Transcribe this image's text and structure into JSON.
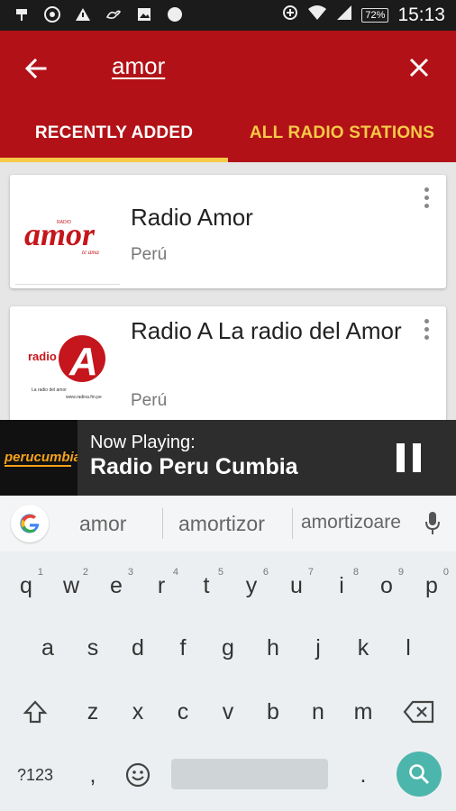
{
  "status_bar": {
    "time": "15:13",
    "battery_percent": "72%",
    "left_icons": [
      "usb-icon",
      "chrome-icon",
      "warning-icon",
      "bird-icon",
      "image-icon",
      "circle-icon"
    ],
    "right_icons": [
      "data-saver-icon",
      "wifi-icon",
      "signal-icon"
    ]
  },
  "toolbar": {
    "search_query": "amor"
  },
  "tabs": [
    {
      "label": "RECENTLY ADDED",
      "active": true
    },
    {
      "label": "ALL RADIO STATIONS",
      "active": false
    }
  ],
  "stations": [
    {
      "name": "Radio Amor",
      "country": "Perú"
    },
    {
      "name": "Radio A La radio del Amor",
      "country": "Perú"
    }
  ],
  "logos": {
    "amor_wordmark": "amor",
    "amor_small": "RADIO",
    "amor_tagline": "te ama",
    "a_wordmark": "radio",
    "a_letter": "A",
    "a_tagline": "La radio del amor",
    "a_url": "www.radioa.fm.pe",
    "cumbia_wordmark": "perucumbia"
  },
  "now_playing": {
    "label": "Now Playing:",
    "station": "Radio Peru Cumbia"
  },
  "keyboard": {
    "suggestions": [
      "amor",
      "amortizor",
      "amortizoare"
    ],
    "row1": [
      {
        "key": "q",
        "hint": "1"
      },
      {
        "key": "w",
        "hint": "2"
      },
      {
        "key": "e",
        "hint": "3"
      },
      {
        "key": "r",
        "hint": "4"
      },
      {
        "key": "t",
        "hint": "5"
      },
      {
        "key": "y",
        "hint": "6"
      },
      {
        "key": "u",
        "hint": "7"
      },
      {
        "key": "i",
        "hint": "8"
      },
      {
        "key": "o",
        "hint": "9"
      },
      {
        "key": "p",
        "hint": "0"
      }
    ],
    "row2": [
      "a",
      "s",
      "d",
      "f",
      "g",
      "h",
      "j",
      "k",
      "l"
    ],
    "row3": [
      "z",
      "x",
      "c",
      "v",
      "b",
      "n",
      "m"
    ],
    "symbols_label": "?123",
    "comma": ",",
    "period": "."
  },
  "colors": {
    "primary": "#b21217",
    "accent": "#f7c948",
    "search_key": "#4db6ac"
  }
}
